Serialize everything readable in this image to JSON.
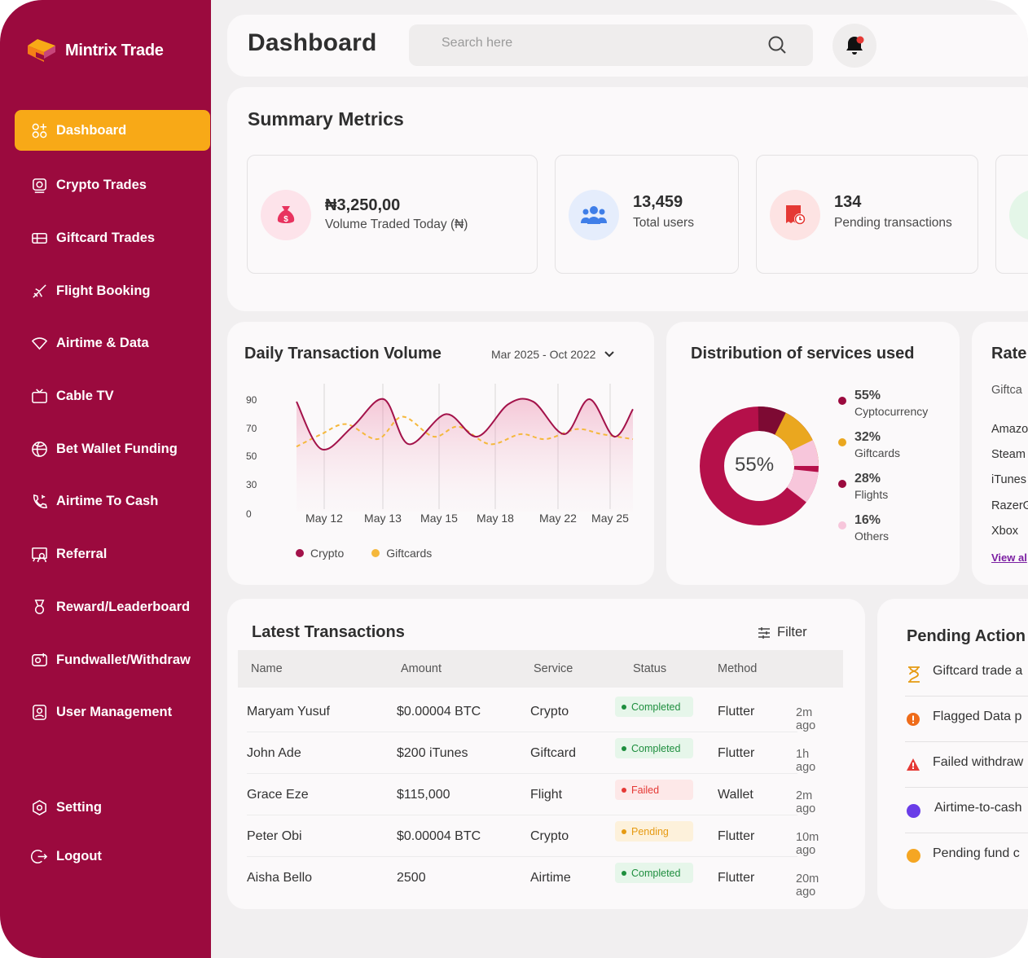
{
  "app": {
    "name": "Mintrix Trade"
  },
  "sidebar": {
    "items": [
      {
        "label": "Dashboard",
        "icon": "dashboard-icon",
        "active": true
      },
      {
        "label": "Crypto Trades",
        "icon": "crypto-icon"
      },
      {
        "label": "Giftcard Trades",
        "icon": "giftcard-icon"
      },
      {
        "label": "Flight Booking",
        "icon": "plane-icon"
      },
      {
        "label": "Airtime & Data",
        "icon": "wifi-icon"
      },
      {
        "label": "Cable TV",
        "icon": "tv-icon"
      },
      {
        "label": "Bet Wallet Funding",
        "icon": "ball-icon"
      },
      {
        "label": "Airtime To Cash",
        "icon": "phone-icon"
      },
      {
        "label": "Referral",
        "icon": "referral-icon"
      },
      {
        "label": "Reward/Leaderboard",
        "icon": "medal-icon"
      },
      {
        "label": "Fundwallet/Withdraw",
        "icon": "wallet-icon"
      },
      {
        "label": "User Management",
        "icon": "user-icon"
      }
    ],
    "setting": "Setting",
    "logout": "Logout"
  },
  "header": {
    "title": "Dashboard",
    "search_placeholder": "Search here"
  },
  "summary": {
    "title": "Summary Metrics",
    "metrics": [
      {
        "value": "₦3,250,00",
        "label": "Volume Traded Today (₦)",
        "icon": "money-bag-icon"
      },
      {
        "value": "13,459",
        "label": "Total users",
        "icon": "users-icon"
      },
      {
        "value": "134",
        "label": "Pending transactions",
        "icon": "pending-receipt-icon"
      }
    ]
  },
  "volume": {
    "title": "Daily Transaction Volume",
    "range": "Mar 2025 - Oct 2022",
    "legend": [
      "Crypto",
      "Giftcards"
    ]
  },
  "distribution": {
    "title": "Distribution of services used",
    "center": "55%",
    "items": [
      {
        "pct": "55%",
        "label": "Cyptocurrency",
        "color": "#9b0a3e"
      },
      {
        "pct": "32%",
        "label": "Giftcards",
        "color": "#eaa71f"
      },
      {
        "pct": "28%",
        "label": "Flights",
        "color": "#9b0a3e"
      },
      {
        "pct": "16%",
        "label": "Others",
        "color": "#f7c6db"
      }
    ]
  },
  "rates": {
    "title": "Rate",
    "subtitle": "Giftca",
    "items": [
      "Amazo",
      "Steam",
      "iTunes",
      "RazerG",
      "Xbox"
    ],
    "link": "View al"
  },
  "transactions": {
    "title": "Latest Transactions",
    "filter": "Filter",
    "headers": [
      "Name",
      "Amount",
      "Service",
      "Status",
      "Method"
    ],
    "rows": [
      {
        "name": "Maryam Yusuf",
        "amount": "$0.00004 BTC",
        "service": "Crypto",
        "status": "Completed",
        "method": "Flutter",
        "time": "2m ago"
      },
      {
        "name": "John Ade",
        "amount": "$200 iTunes",
        "service": "Giftcard",
        "status": "Completed",
        "method": "Flutter",
        "time": "1h ago"
      },
      {
        "name": "Grace Eze",
        "amount": "$115,000",
        "service": "Flight",
        "status": "Failed",
        "method": "Wallet",
        "time": "2m ago"
      },
      {
        "name": "Peter Obi",
        "amount": "$0.00004 BTC",
        "service": "Crypto",
        "status": "Pending",
        "method": "Flutter",
        "time": "10m ago"
      },
      {
        "name": "Aisha Bello",
        "amount": "2500",
        "service": "Airtime",
        "status": "Completed",
        "method": "Flutter",
        "time": "20m ago"
      }
    ]
  },
  "pending": {
    "title": "Pending Action",
    "items": [
      {
        "text": "Giftcard trade a",
        "icon": "hourglass-icon"
      },
      {
        "text": "Flagged  Data p",
        "icon": "alert-circle-icon"
      },
      {
        "text": "Failed withdraw",
        "icon": "warning-icon"
      },
      {
        "text": "Airtime-to-cash",
        "icon": "purple-dot-icon"
      },
      {
        "text": "Pending fund c",
        "icon": "orange-dot-icon"
      }
    ]
  },
  "chart_data": {
    "type": "area",
    "categories": [
      "May 12",
      "May 13",
      "May 15",
      "May 18",
      "May 22",
      "May 25"
    ],
    "y_ticks": [
      "90",
      "70",
      "50",
      "30",
      "0"
    ],
    "ylim": [
      0,
      90
    ],
    "series": [
      {
        "name": "Crypto",
        "color": "#a3124a",
        "x": [
          0,
          0.4,
          0.9,
          1.4,
          1.8,
          2.4,
          2.9,
          3.4,
          3.8,
          4.3,
          4.7,
          5.1,
          5.4
        ],
        "values": [
          88,
          50,
          68,
          90,
          54,
          78,
          60,
          86,
          88,
          62,
          90,
          60,
          82
        ]
      },
      {
        "name": "Giftcards",
        "color": "#f5b83c",
        "x": [
          0,
          0.4,
          0.8,
          1.3,
          1.7,
          2.2,
          2.6,
          3.1,
          3.6,
          4.0,
          4.5,
          4.9,
          5.4
        ],
        "values": [
          52,
          62,
          70,
          58,
          76,
          60,
          68,
          54,
          62,
          58,
          66,
          62,
          58
        ]
      }
    ]
  }
}
